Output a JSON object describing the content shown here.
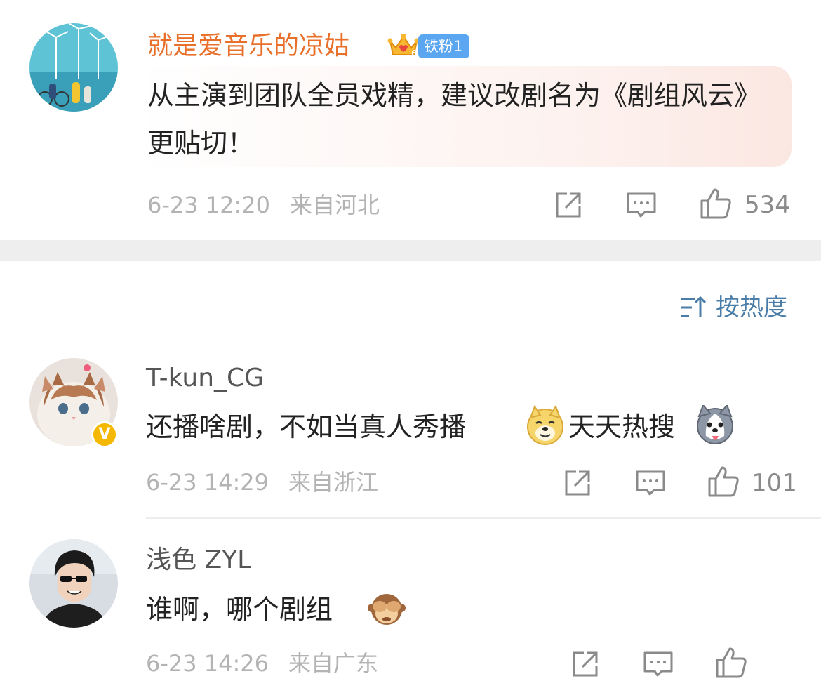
{
  "pinned_comment": {
    "username": "就是爱音乐的凉姑",
    "badge": "铁粉1",
    "text": "从主演到团队全员戏精，建议改剧名为《剧组风云》更贴切！",
    "timestamp": "6-23 12:20",
    "location": "来自河北",
    "likes": "534"
  },
  "sort": {
    "label": "按热度"
  },
  "comments": [
    {
      "username": "T-kun_CG",
      "text_parts": [
        "还播啥剧，不如当真人秀播",
        "天天热搜"
      ],
      "timestamp": "6-23 14:29",
      "location": "来自浙江",
      "likes": "101"
    },
    {
      "username": "浅色 ZYL",
      "text": "谁啊，哪个剧组",
      "timestamp": "6-23 14:26",
      "location": "来自广东"
    }
  ],
  "colors": {
    "pinned_username": "#e8702a",
    "username": "#555555",
    "meta": "#b3b3b3",
    "sort_accent": "#4a7da8",
    "badge": "#5aa6f0",
    "verified": "#f5b800"
  }
}
